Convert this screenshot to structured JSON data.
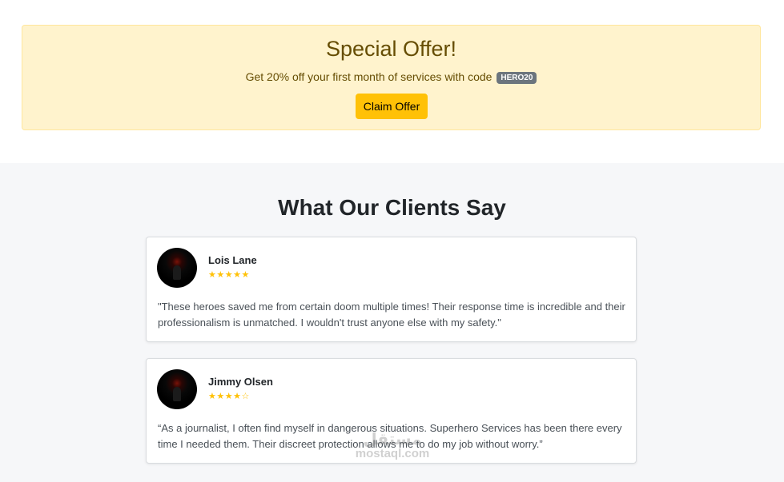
{
  "offer": {
    "title": "Special Offer!",
    "text": "Get 20% off your first month of services with code",
    "code": "HERO20",
    "button_label": "Claim Offer"
  },
  "testimonials": {
    "heading": "What Our Clients Say",
    "items": [
      {
        "name": "Lois Lane",
        "stars": "★★★★★",
        "rating": 5,
        "quote": "\"These heroes saved me from certain doom multiple times! Their response time is incredible and their professionalism is unmatched. I wouldn't trust anyone else with my safety.\""
      },
      {
        "name": "Jimmy Olsen",
        "stars": "★★★★☆",
        "rating": 4,
        "quote": "“As a journalist, I often find myself in dangerous situations. Superhero Services has been there every time I needed them. Their discreet protection allows me to do my job without worry.”"
      }
    ]
  },
  "watermark": {
    "arabic": "مستقل",
    "latin": "mostaql.com"
  },
  "colors": {
    "alert_bg": "#fff3cd",
    "alert_text": "#664d03",
    "button": "#ffc107",
    "badge": "#6c757d",
    "star": "#ffc107"
  }
}
